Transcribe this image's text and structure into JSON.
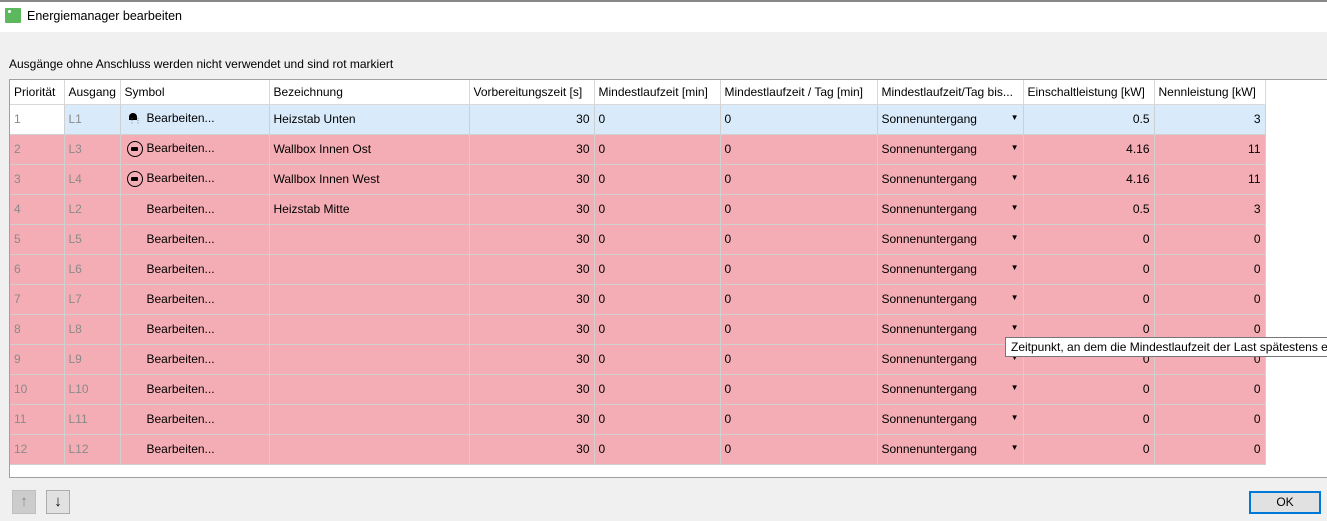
{
  "window": {
    "title": "Energiemanager bearbeiten"
  },
  "hint": "Ausgänge ohne Anschluss werden nicht verwendet und sind rot markiert",
  "columns": [
    "Priorität",
    "Ausgang",
    "Symbol",
    "Bezeichnung",
    "Vorbereitungszeit [s]",
    "Mindestlaufzeit [min]",
    "Mindestlaufzeit / Tag [min]",
    "Mindestlaufzeit/Tag bis...",
    "Einschaltleistung [kW]",
    "Nennleistung [kW]"
  ],
  "rows": [
    {
      "prio": "1",
      "out": "L1",
      "icon": "shower-icon",
      "edit": "Bearbeiten...",
      "name": "Heizstab Unten",
      "prep": "30",
      "min": "0",
      "minday": "0",
      "until": "Sonnenuntergang",
      "on": "0.5",
      "nom": "3",
      "selected": true
    },
    {
      "prio": "2",
      "out": "L3",
      "icon": "car-icon",
      "edit": "Bearbeiten...",
      "name": "Wallbox Innen Ost",
      "prep": "30",
      "min": "0",
      "minday": "0",
      "until": "Sonnenuntergang",
      "on": "4.16",
      "nom": "11"
    },
    {
      "prio": "3",
      "out": "L4",
      "icon": "car-icon",
      "edit": "Bearbeiten...",
      "name": "Wallbox Innen West",
      "prep": "30",
      "min": "0",
      "minday": "0",
      "until": "Sonnenuntergang",
      "on": "4.16",
      "nom": "11"
    },
    {
      "prio": "4",
      "out": "L2",
      "icon": "",
      "edit": "Bearbeiten...",
      "name": "Heizstab Mitte",
      "prep": "30",
      "min": "0",
      "minday": "0",
      "until": "Sonnenuntergang",
      "on": "0.5",
      "nom": "3"
    },
    {
      "prio": "5",
      "out": "L5",
      "icon": "",
      "edit": "Bearbeiten...",
      "name": "",
      "prep": "30",
      "min": "0",
      "minday": "0",
      "until": "Sonnenuntergang",
      "on": "0",
      "nom": "0"
    },
    {
      "prio": "6",
      "out": "L6",
      "icon": "",
      "edit": "Bearbeiten...",
      "name": "",
      "prep": "30",
      "min": "0",
      "minday": "0",
      "until": "Sonnenuntergang",
      "on": "0",
      "nom": "0"
    },
    {
      "prio": "7",
      "out": "L7",
      "icon": "",
      "edit": "Bearbeiten...",
      "name": "",
      "prep": "30",
      "min": "0",
      "minday": "0",
      "until": "Sonnenuntergang",
      "on": "0",
      "nom": "0"
    },
    {
      "prio": "8",
      "out": "L8",
      "icon": "",
      "edit": "Bearbeiten...",
      "name": "",
      "prep": "30",
      "min": "0",
      "minday": "0",
      "until": "Sonnenuntergang",
      "on": "0",
      "nom": "0"
    },
    {
      "prio": "9",
      "out": "L9",
      "icon": "",
      "edit": "Bearbeiten...",
      "name": "",
      "prep": "30",
      "min": "0",
      "minday": "0",
      "until": "Sonnenuntergang",
      "on": "0",
      "nom": "0"
    },
    {
      "prio": "10",
      "out": "L10",
      "icon": "",
      "edit": "Bearbeiten...",
      "name": "",
      "prep": "30",
      "min": "0",
      "minday": "0",
      "until": "Sonnenuntergang",
      "on": "0",
      "nom": "0"
    },
    {
      "prio": "11",
      "out": "L11",
      "icon": "",
      "edit": "Bearbeiten...",
      "name": "",
      "prep": "30",
      "min": "0",
      "minday": "0",
      "until": "Sonnenuntergang",
      "on": "0",
      "nom": "0"
    },
    {
      "prio": "12",
      "out": "L12",
      "icon": "",
      "edit": "Bearbeiten...",
      "name": "",
      "prep": "30",
      "min": "0",
      "minday": "0",
      "until": "Sonnenuntergang",
      "on": "0",
      "nom": "0"
    }
  ],
  "tooltip": "Zeitpunkt, an dem die Mindestlaufzeit der Last spätestens er",
  "buttons": {
    "up": "↑",
    "down": "↓",
    "ok": "OK"
  }
}
